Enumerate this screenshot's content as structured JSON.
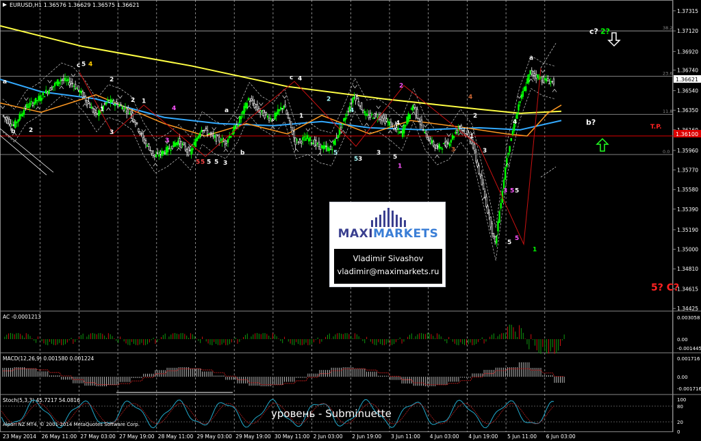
{
  "chart_data": {
    "type": "line",
    "symbol_header": "EURUSD,H1 1.36576 1.36629 1.36575 1.36621",
    "x_ticks": [
      "23 May 2014",
      "26 May 11:00",
      "27 May 03:00",
      "27 May 19:00",
      "28 May 11:00",
      "29 May 03:00",
      "29 May 19:00",
      "30 May 11:00",
      "2 Jun 03:00",
      "2 Jun 19:00",
      "3 Jun 11:00",
      "4 Jun 03:00",
      "4 Jun 19:00",
      "5 Jun 11:00",
      "6 Jun 03:00"
    ],
    "y_ticks": [
      "1.37315",
      "1.37120",
      "1.36920",
      "1.36740",
      "1.36540",
      "1.36350",
      "1.36160",
      "1.35960",
      "1.35770",
      "1.35580",
      "1.35390",
      "1.35190",
      "1.35000",
      "1.34810",
      "1.34615",
      "1.34425"
    ],
    "ylim": [
      1.344,
      1.3742
    ],
    "current_price": "1.36621",
    "tp_price": "1.36100",
    "tp_label": "T.P.",
    "fib_levels": [
      {
        "label": "38.2",
        "value": 1.3712
      },
      {
        "label": "23.6",
        "value": 1.3668
      },
      {
        "label": "11.8",
        "value": 1.3631
      },
      {
        "label": "0.0",
        "value": 1.3592
      }
    ],
    "price_series": [
      [
        "23 May 00:00",
        1.363
      ],
      [
        "23 May 12:00",
        1.362
      ],
      [
        "26 May 00:00",
        1.3638
      ],
      [
        "26 May 08:00",
        1.3645
      ],
      [
        "26 May 16:00",
        1.3655
      ],
      [
        "27 May 00:00",
        1.3665
      ],
      [
        "27 May 06:00",
        1.3661
      ],
      [
        "27 May 12:00",
        1.3648
      ],
      [
        "27 May 18:00",
        1.363
      ],
      [
        "28 May 00:00",
        1.3644
      ],
      [
        "28 May 06:00",
        1.364
      ],
      [
        "28 May 12:00",
        1.3632
      ],
      [
        "28 May 18:00",
        1.3607
      ],
      [
        "29 May 00:00",
        1.359
      ],
      [
        "29 May 06:00",
        1.3596
      ],
      [
        "29 May 12:00",
        1.3605
      ],
      [
        "29 May 18:00",
        1.3593
      ],
      [
        "30 May 00:00",
        1.3618
      ],
      [
        "30 May 06:00",
        1.3609
      ],
      [
        "30 May 12:00",
        1.3604
      ],
      [
        "30 May 18:00",
        1.362
      ],
      [
        "2 Jun 00:00",
        1.3646
      ],
      [
        "2 Jun 04:00",
        1.3633
      ],
      [
        "2 Jun 08:00",
        1.3626
      ],
      [
        "2 Jun 12:00",
        1.364
      ],
      [
        "2 Jun 16:00",
        1.3604
      ],
      [
        "2 Jun 20:00",
        1.3608
      ],
      [
        "3 Jun 00:00",
        1.36
      ],
      [
        "3 Jun 04:00",
        1.3597
      ],
      [
        "3 Jun 08:00",
        1.3622
      ],
      [
        "3 Jun 12:00",
        1.365
      ],
      [
        "3 Jun 16:00",
        1.3629
      ],
      [
        "3 Jun 20:00",
        1.363
      ],
      [
        "4 Jun 00:00",
        1.3622
      ],
      [
        "4 Jun 04:00",
        1.3612
      ],
      [
        "4 Jun 08:00",
        1.364
      ],
      [
        "4 Jun 12:00",
        1.3612
      ],
      [
        "4 Jun 16:00",
        1.3598
      ],
      [
        "4 Jun 20:00",
        1.3603
      ],
      [
        "5 Jun 00:00",
        1.362
      ],
      [
        "5 Jun 04:00",
        1.3605
      ],
      [
        "5 Jun 08:00",
        1.3557
      ],
      [
        "5 Jun 11:00",
        1.3505
      ],
      [
        "5 Jun 13:00",
        1.359
      ],
      [
        "5 Jun 16:00",
        1.364
      ],
      [
        "5 Jun 19:00",
        1.3672
      ],
      [
        "5 Jun 22:00",
        1.3665
      ],
      [
        "6 Jun 01:00",
        1.3662
      ]
    ],
    "ma_yellow": [
      [
        0,
        1.3717
      ],
      [
        120,
        1.3697
      ],
      [
        280,
        1.3678
      ],
      [
        420,
        1.3658
      ],
      [
        560,
        1.3646
      ],
      [
        700,
        1.3636
      ],
      [
        760,
        1.3632
      ],
      [
        820,
        1.3634
      ]
    ],
    "ma_blue": [
      [
        0,
        1.3665
      ],
      [
        60,
        1.3653
      ],
      [
        140,
        1.3646
      ],
      [
        240,
        1.3628
      ],
      [
        320,
        1.3622
      ],
      [
        400,
        1.362
      ],
      [
        470,
        1.3624
      ],
      [
        540,
        1.3618
      ],
      [
        620,
        1.3616
      ],
      [
        700,
        1.3618
      ],
      [
        760,
        1.3616
      ],
      [
        820,
        1.3625
      ]
    ],
    "ma_orange": [
      [
        0,
        1.3642
      ],
      [
        60,
        1.3633
      ],
      [
        140,
        1.365
      ],
      [
        240,
        1.3622
      ],
      [
        300,
        1.361
      ],
      [
        360,
        1.3622
      ],
      [
        420,
        1.3612
      ],
      [
        470,
        1.363
      ],
      [
        540,
        1.3612
      ],
      [
        600,
        1.3625
      ],
      [
        680,
        1.3618
      ],
      [
        740,
        1.3612
      ],
      [
        770,
        1.361
      ],
      [
        800,
        1.3632
      ],
      [
        820,
        1.364
      ]
    ],
    "wave_labels": [
      {
        "text": "a",
        "color": "#ffffff",
        "x": 4,
        "y": 1.3661
      },
      {
        "text": "b",
        "color": "#ffffff",
        "x": 16,
        "y": 1.3613
      },
      {
        "text": "2",
        "color": "#ffffff",
        "x": 42,
        "y": 1.3614
      },
      {
        "text": "c",
        "color": "#ffffff",
        "x": 112,
        "y": 1.3677
      },
      {
        "text": "5",
        "color": "#ffffff",
        "x": 119,
        "y": 1.3678
      },
      {
        "text": "4",
        "color": "#ffcc00",
        "x": 129,
        "y": 1.3678
      },
      {
        "text": "2",
        "color": "#ffffff",
        "x": 160,
        "y": 1.3663
      },
      {
        "text": "1",
        "color": "#ffffff",
        "x": 146,
        "y": 1.3634
      },
      {
        "text": "3",
        "color": "#ffffff",
        "x": 160,
        "y": 1.3612
      },
      {
        "text": "2",
        "color": "#ffffff",
        "x": 191,
        "y": 1.3643
      },
      {
        "text": "1",
        "color": "#ffffff",
        "x": 207,
        "y": 1.3642
      },
      {
        "text": "3",
        "color": "#ff55ff",
        "x": 241,
        "y": 1.3604
      },
      {
        "text": "4",
        "color": "#ff55ff",
        "x": 251,
        "y": 1.3635
      },
      {
        "text": "5",
        "color": "#ff4444",
        "x": 286,
        "y": 1.3583
      },
      {
        "text": "5",
        "color": "#ff4444",
        "x": 293,
        "y": 1.3583
      },
      {
        "text": "5",
        "color": "#ffffff",
        "x": 302,
        "y": 1.3583
      },
      {
        "text": "5",
        "color": "#ffffff",
        "x": 313,
        "y": 1.3583
      },
      {
        "text": "3",
        "color": "#ffffff",
        "x": 326,
        "y": 1.3582
      },
      {
        "text": "a",
        "color": "#ffffff",
        "x": 328,
        "y": 1.3633
      },
      {
        "text": "b",
        "color": "#ffffff",
        "x": 351,
        "y": 1.3592
      },
      {
        "text": "c",
        "color": "#ffffff",
        "x": 423,
        "y": 1.3665
      },
      {
        "text": "4",
        "color": "#ffffff",
        "x": 435,
        "y": 1.3664
      },
      {
        "text": "1",
        "color": "#ffffff",
        "x": 437,
        "y": 1.3628
      },
      {
        "text": "2",
        "color": "#aaffff",
        "x": 477,
        "y": 1.3644
      },
      {
        "text": "4",
        "color": "#aaffff",
        "x": 511,
        "y": 1.3633
      },
      {
        "text": "5",
        "color": "#aaffff",
        "x": 487,
        "y": 1.3592
      },
      {
        "text": "5",
        "color": "#aaffff",
        "x": 517,
        "y": 1.3586
      },
      {
        "text": "3",
        "color": "#ffffff",
        "x": 523,
        "y": 1.3586
      },
      {
        "text": "3",
        "color": "#ffffff",
        "x": 550,
        "y": 1.3592
      },
      {
        "text": "2",
        "color": "#ff55ff",
        "x": 583,
        "y": 1.3657
      },
      {
        "text": "4",
        "color": "#ffffff",
        "x": 578,
        "y": 1.3621
      },
      {
        "text": "5",
        "color": "#ffffff",
        "x": 574,
        "y": 1.3588
      },
      {
        "text": "1",
        "color": "#ff55ff",
        "x": 581,
        "y": 1.3579
      },
      {
        "text": "4",
        "color": "#cc6633",
        "x": 684,
        "y": 1.3646
      },
      {
        "text": "2",
        "color": "#ffffff",
        "x": 691,
        "y": 1.3628
      },
      {
        "text": "3",
        "color": "#cc6633",
        "x": 659,
        "y": 1.3595
      },
      {
        "text": "1",
        "color": "#ffffff",
        "x": 686,
        "y": 1.3608
      },
      {
        "text": "3",
        "color": "#ffffff",
        "x": 705,
        "y": 1.3594
      },
      {
        "text": "4",
        "color": "#ffffff",
        "x": 749,
        "y": 1.3622
      },
      {
        "text": "3",
        "color": "#ff55ff",
        "x": 735,
        "y": 1.3555
      },
      {
        "text": "5",
        "color": "#ff55ff",
        "x": 745,
        "y": 1.3555
      },
      {
        "text": "5",
        "color": "#ffffff",
        "x": 752,
        "y": 1.3555
      },
      {
        "text": "5",
        "color": "#ffffff",
        "x": 741,
        "y": 1.3505
      },
      {
        "text": "5",
        "color": "#ff55ff",
        "x": 752,
        "y": 1.3509
      },
      {
        "text": "1",
        "color": "#00ff00",
        "x": 778,
        "y": 1.3498
      },
      {
        "text": "a",
        "color": "#ffffff",
        "x": 773,
        "y": 1.3684
      },
      {
        "text": "c?",
        "color": "#ffffff",
        "x": 861,
        "y": 1.3709
      },
      {
        "text": "2?",
        "color": "#00ff00",
        "x": 877,
        "y": 1.3709
      },
      {
        "text": "b?",
        "color": "#ffffff",
        "x": 856,
        "y": 1.3621
      },
      {
        "text": "5? C?",
        "color": "#ff2222",
        "x": 951,
        "y": 1.346
      }
    ],
    "indicators": [
      {
        "name": "AC",
        "header": "AC -0.0001213",
        "ticks": [
          "0.003058",
          "0.00",
          "-0.001445"
        ]
      },
      {
        "name": "MACD",
        "header": "MACD(12,26,9) 0.001580 0.001224",
        "ticks": [
          "0.001716",
          "0.00",
          "-0.001716"
        ]
      },
      {
        "name": "Stoch",
        "header": "Stoch(5,3,3) 45.7217 54.0816",
        "ticks": [
          "100",
          "80",
          "20",
          "0"
        ]
      }
    ],
    "footer": "Alpari NZ MT4, © 2001-2014 MetaQuotes Software Corp.",
    "subtitle": "уровень - Subminuette"
  },
  "logo": {
    "brand_part1": "MAXI",
    "brand_part2": "MARKETS",
    "author": "Vladimir Sivashov",
    "email": "vladimir@maximarkets.ru"
  },
  "colors": {
    "bull": "#00ff00",
    "bear": "#ffffff",
    "ma_yellow": "#ffff44",
    "ma_blue": "#33aaff",
    "ma_orange": "#ff9922",
    "tp_line": "#dd0000",
    "grid": "#bbbbbb",
    "hist": "#0f9a0f",
    "hist_red": "#cc1111"
  }
}
